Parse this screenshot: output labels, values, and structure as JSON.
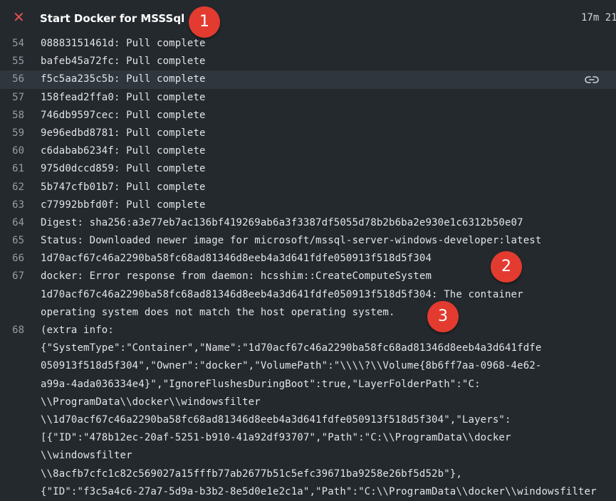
{
  "header": {
    "title": "Start Docker for MSSSql",
    "duration": "17m 21"
  },
  "markers": [
    "1",
    "2",
    "3"
  ],
  "log": [
    {
      "n": "54",
      "t": "08883151461d: Pull complete"
    },
    {
      "n": "55",
      "t": "bafeb45a72fc: Pull complete"
    },
    {
      "n": "56",
      "t": "f5c5aa235c5b: Pull complete"
    },
    {
      "n": "57",
      "t": "158fead2ffa0: Pull complete"
    },
    {
      "n": "58",
      "t": "746db9597cec: Pull complete"
    },
    {
      "n": "59",
      "t": "9e96edbd8781: Pull complete"
    },
    {
      "n": "60",
      "t": "c6dabab6234f: Pull complete"
    },
    {
      "n": "61",
      "t": "975d0dccd859: Pull complete"
    },
    {
      "n": "62",
      "t": "5b747cfb01b7: Pull complete"
    },
    {
      "n": "63",
      "t": "c77992bbfd0f: Pull complete"
    },
    {
      "n": "64",
      "t": "Digest: sha256:a3e77eb7ac136bf419269ab6a3f3387df5055d78b2b6ba2e930e1c6312b50e07"
    },
    {
      "n": "65",
      "t": "Status: Downloaded newer image for microsoft/mssql-server-windows-developer:latest"
    },
    {
      "n": "66",
      "t": "1d70acf67c46a2290ba58fc68ad81346d8eeb4a3d641fdfe050913f518d5f304"
    },
    {
      "n": "67",
      "t": "docker: Error response from daemon: hcsshim::CreateComputeSystem"
    },
    {
      "n": "",
      "t": "1d70acf67c46a2290ba58fc68ad81346d8eeb4a3d641fdfe050913f518d5f304: The container"
    },
    {
      "n": "",
      "t": "operating system does not match the host operating system."
    },
    {
      "n": "68",
      "t": "(extra info:"
    },
    {
      "n": "",
      "t": "{\"SystemType\":\"Container\",\"Name\":\"1d70acf67c46a2290ba58fc68ad81346d8eeb4a3d641fdfe"
    },
    {
      "n": "",
      "t": "050913f518d5f304\",\"Owner\":\"docker\",\"VolumePath\":\"\\\\\\\\?\\\\Volume{8b6ff7aa-0968-4e62-"
    },
    {
      "n": "",
      "t": "a99a-4ada036334e4}\",\"IgnoreFlushesDuringBoot\":true,\"LayerFolderPath\":\"C:"
    },
    {
      "n": "",
      "t": "\\\\ProgramData\\\\docker\\\\windowsfilter"
    },
    {
      "n": "",
      "t": "\\\\1d70acf67c46a2290ba58fc68ad81346d8eeb4a3d641fdfe050913f518d5f304\",\"Layers\":"
    },
    {
      "n": "",
      "t": "[{\"ID\":\"478b12ec-20af-5251-b910-41a92df93707\",\"Path\":\"C:\\\\ProgramData\\\\docker"
    },
    {
      "n": "",
      "t": "\\\\windowsfilter"
    },
    {
      "n": "",
      "t": "\\\\8acfb7cfc1c82c569027a15fffb77ab2677b51c5efc39671ba9258e26bf5d52b\"},"
    },
    {
      "n": "",
      "t": "{\"ID\":\"f3c5a4c6-27a7-5d9a-b3b2-8e5d0e1e2c1a\",\"Path\":\"C:\\\\ProgramData\\\\docker\\\\windowsfilter"
    }
  ]
}
